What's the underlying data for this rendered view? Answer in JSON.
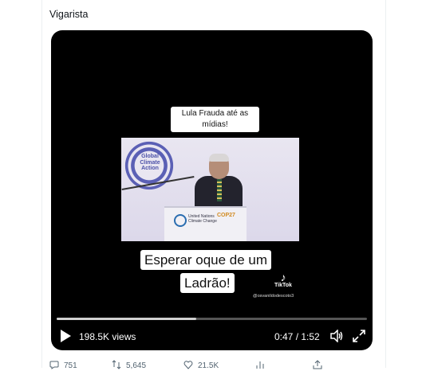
{
  "tweet": {
    "text": "Vigarista"
  },
  "video": {
    "caption_top": "Lula Frauda até as mídias!",
    "caption_bottom_line1": "Esperar oque de um",
    "caption_bottom_line2": "Ladrão!",
    "frame": {
      "logo_text": "Global Climate Action",
      "podium_text_1": "United Nations",
      "podium_text_2": "Climate Change",
      "podium_badge": "COP27"
    },
    "tiktok_label": "TikTok",
    "tiktok_user": "@osvanildodescoto3",
    "progress": 0.45,
    "views": "198.5K views",
    "time": "0:47 / 1:52"
  },
  "actions": {
    "replies": "751",
    "retweets": "5,645",
    "likes": "21.5K"
  },
  "colors": {
    "video_bg": "#000000",
    "accent_logo": "#5b60b5",
    "muted": "#536471"
  },
  "icons": [
    "play-icon",
    "volume-icon",
    "fullscreen-icon",
    "tiktok-icon",
    "reply-icon",
    "retweet-icon",
    "like-icon",
    "analytics-icon",
    "share-icon"
  ]
}
